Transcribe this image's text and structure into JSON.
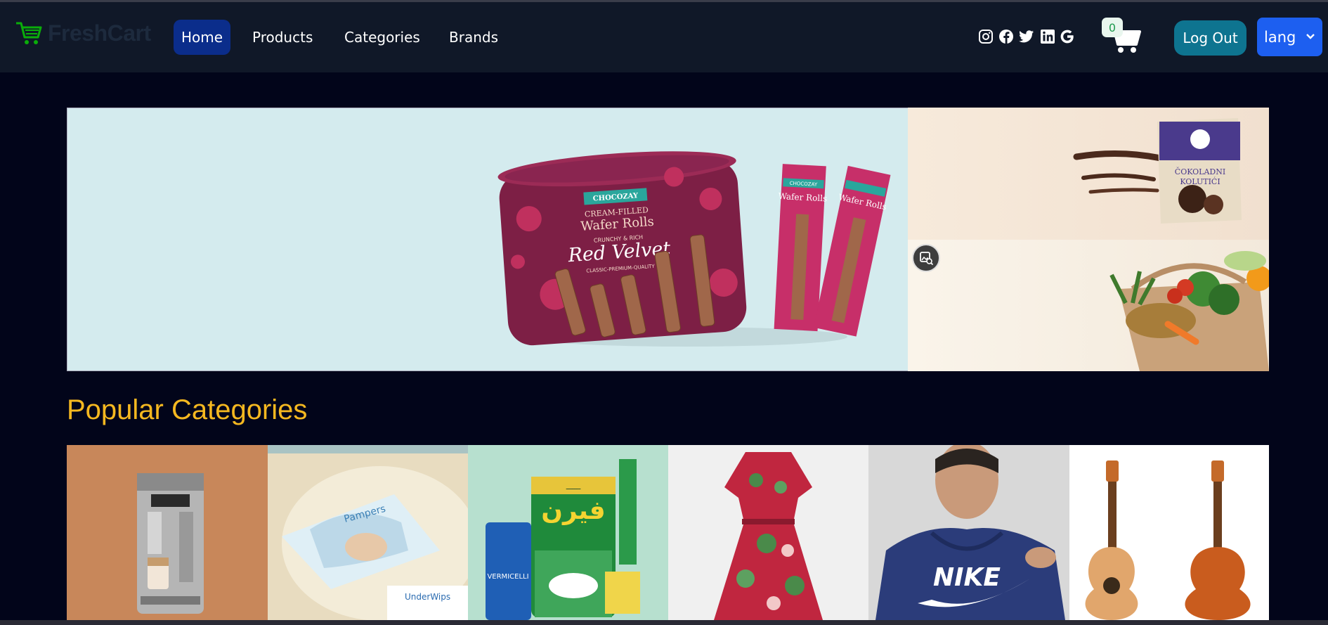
{
  "brand": {
    "name": "FreshCart",
    "icon": "cart-icon",
    "color": "#0aad0a"
  },
  "nav": {
    "links": [
      {
        "label": "Home",
        "active": true
      },
      {
        "label": "Products",
        "active": false
      },
      {
        "label": "Categories",
        "active": false
      },
      {
        "label": "Brands",
        "active": false
      }
    ]
  },
  "social": [
    "instagram-icon",
    "facebook-icon",
    "twitter-icon",
    "linkedin-icon",
    "google-icon"
  ],
  "cart": {
    "count": "0",
    "icon": "cart-icon"
  },
  "actions": {
    "logout_label": "Log Out",
    "lang_label": "lang"
  },
  "hero": {
    "main_image": "red-velvet-wafer-rolls",
    "product_text": {
      "brand": "CHOCOZAY",
      "line1": "CREAM-FILLED",
      "line2": "Wafer Rolls",
      "line3": "CRUNCHY & RICH",
      "line4": "Red Velvet",
      "line5": "CLASSIC-PREMIUM-QUALITY",
      "stick": "Wafer Rolls",
      "stick_brand": "CHOCOZAY"
    },
    "side_top_text": {
      "line1": "ČOKOLADNI",
      "line2": "KOLUTIĆI"
    },
    "side_bottom_image": "grocery-bag-vegetables"
  },
  "popular": {
    "title": "Popular Categories",
    "items": [
      {
        "image": "coffee-machine"
      },
      {
        "image": "baby-diapers",
        "text1": "Pampers",
        "text2": "UnderWips"
      },
      {
        "image": "groceries",
        "text1": "VERMICELLI"
      },
      {
        "image": "floral-dress"
      },
      {
        "image": "nike-hoodie",
        "text1": "NIKE"
      },
      {
        "image": "guitars"
      }
    ]
  },
  "colors": {
    "navbar": "#101828",
    "active_link": "#0b2d8b",
    "logout": "#0e7490",
    "lang": "#1d5ff0",
    "accent_title": "#f5b820"
  }
}
